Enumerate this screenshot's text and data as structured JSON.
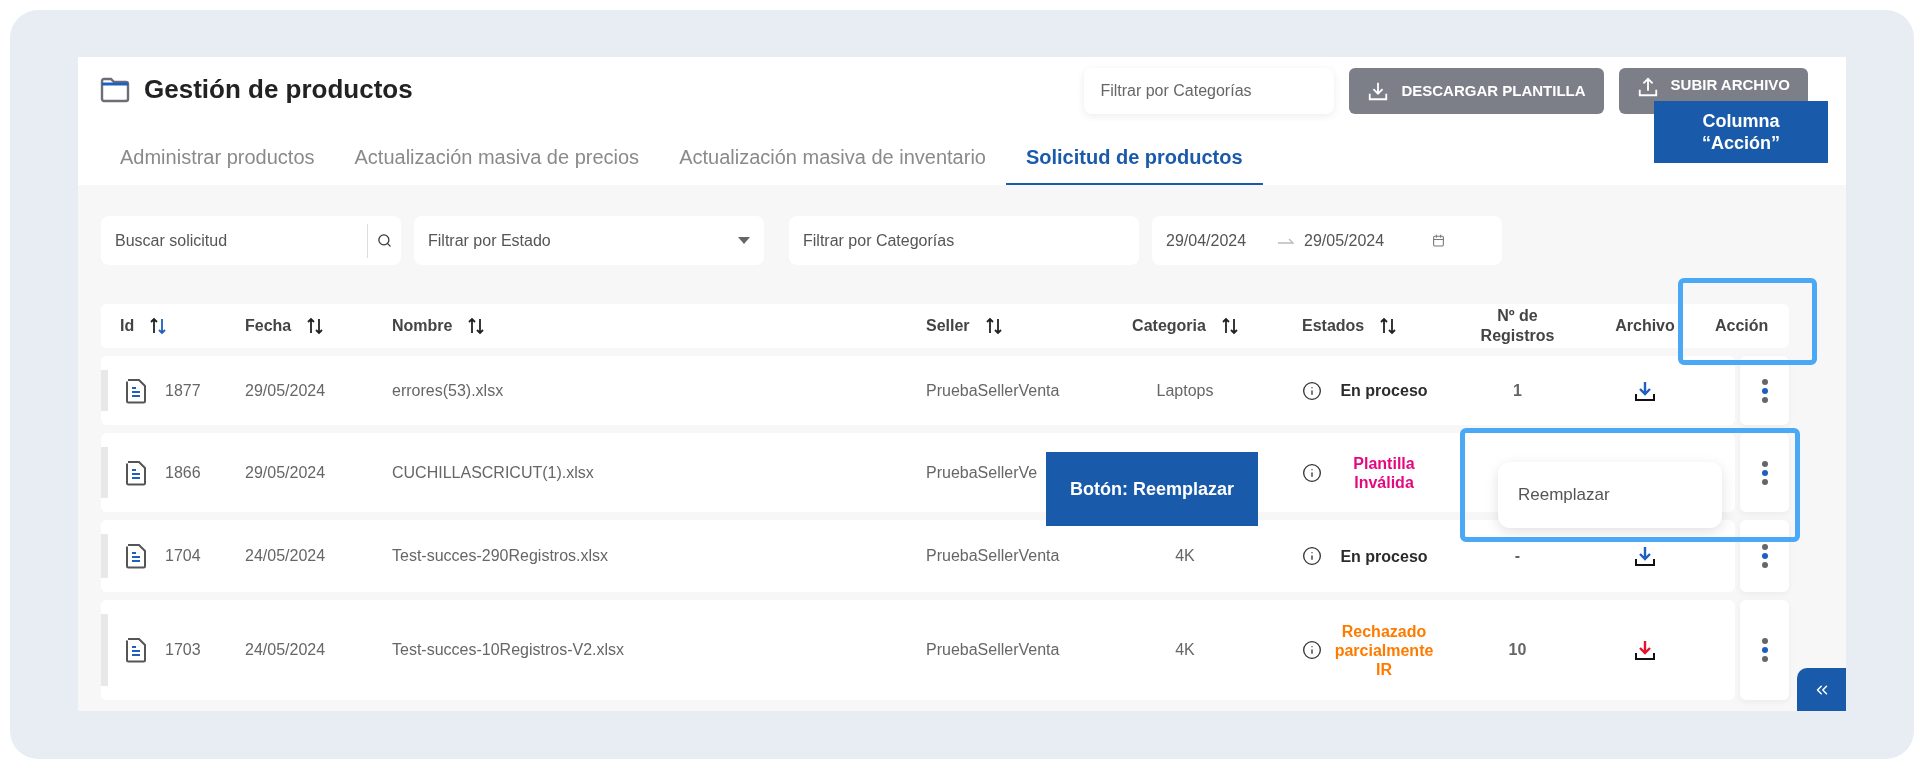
{
  "header": {
    "title": "Gestión de productos",
    "category_filter": {
      "placeholder": "Filtrar por Categorías"
    },
    "buttons": [
      {
        "label": "DESCARGAR PLANTILLA",
        "kind": "download"
      },
      {
        "label": "SUBIR ARCHIVO",
        "kind": "upload"
      }
    ]
  },
  "tabs": [
    {
      "label": "Administrar productos",
      "selected": false
    },
    {
      "label": "Actualización masiva de precios",
      "selected": false
    },
    {
      "label": "Actualización masiva de inventario",
      "selected": false
    },
    {
      "label": "Solicitud de productos",
      "selected": true
    }
  ],
  "filters": {
    "search": {
      "placeholder": "Buscar solicitud"
    },
    "state": {
      "placeholder": "Filtrar por Estado"
    },
    "category": {
      "placeholder": "Filtrar por Categorías"
    },
    "date_from": "29/04/2024",
    "date_to": "29/05/2024"
  },
  "table": {
    "columns": [
      {
        "label": "Id",
        "sorted": true
      },
      {
        "label": "Fecha",
        "sorted": false
      },
      {
        "label": "Nombre",
        "sorted": false
      },
      {
        "label": "Seller",
        "sorted": false
      },
      {
        "label": "Categoria",
        "sorted": false
      },
      {
        "label": "Estados",
        "sorted": false
      },
      {
        "label": "Nº de Registros"
      },
      {
        "label": "Archivo"
      },
      {
        "label": "Acción"
      }
    ],
    "rows": [
      {
        "id": "1877",
        "fecha": "29/05/2024",
        "nombre": "errores(53).xlsx",
        "seller": "PruebaSellerVenta",
        "categoria": "Laptops",
        "estado": {
          "text": "En proceso",
          "color": "#2b2b2b"
        },
        "registros": "1",
        "archivo": {
          "color": "#1f5fbf"
        }
      },
      {
        "id": "1866",
        "fecha": "29/05/2024",
        "nombre": "CUCHILLASCRICUT(1).xlsx",
        "seller": "PruebaSellerVe",
        "estado": {
          "text": "Plantilla Inválida",
          "color": "#e5097f"
        },
        "menu": [
          "Reemplazar"
        ]
      },
      {
        "id": "1704",
        "fecha": "24/05/2024",
        "nombre": "Test-succes-290Registros.xlsx",
        "seller": "PruebaSellerVenta",
        "categoria": "4K",
        "estado": {
          "text": "En proceso",
          "color": "#2b2b2b"
        },
        "registros": "-",
        "archivo": {
          "color": "#1f5fbf"
        }
      },
      {
        "id": "1703",
        "fecha": "24/05/2024",
        "nombre": "Test-succes-10Registros-V2.xlsx",
        "seller": "PruebaSellerVenta",
        "categoria": "4K",
        "estado": {
          "text": "Rechazado parcialmente IR",
          "color": "#ff7b00"
        },
        "registros": "10",
        "archivo": {
          "color": "#e8112d"
        }
      }
    ]
  },
  "annotations": [
    {
      "kind": "label",
      "text": "Columna “Acción”"
    },
    {
      "kind": "outline"
    },
    {
      "kind": "outline"
    },
    {
      "kind": "label",
      "text": "Botón: Reemplazar"
    }
  ]
}
